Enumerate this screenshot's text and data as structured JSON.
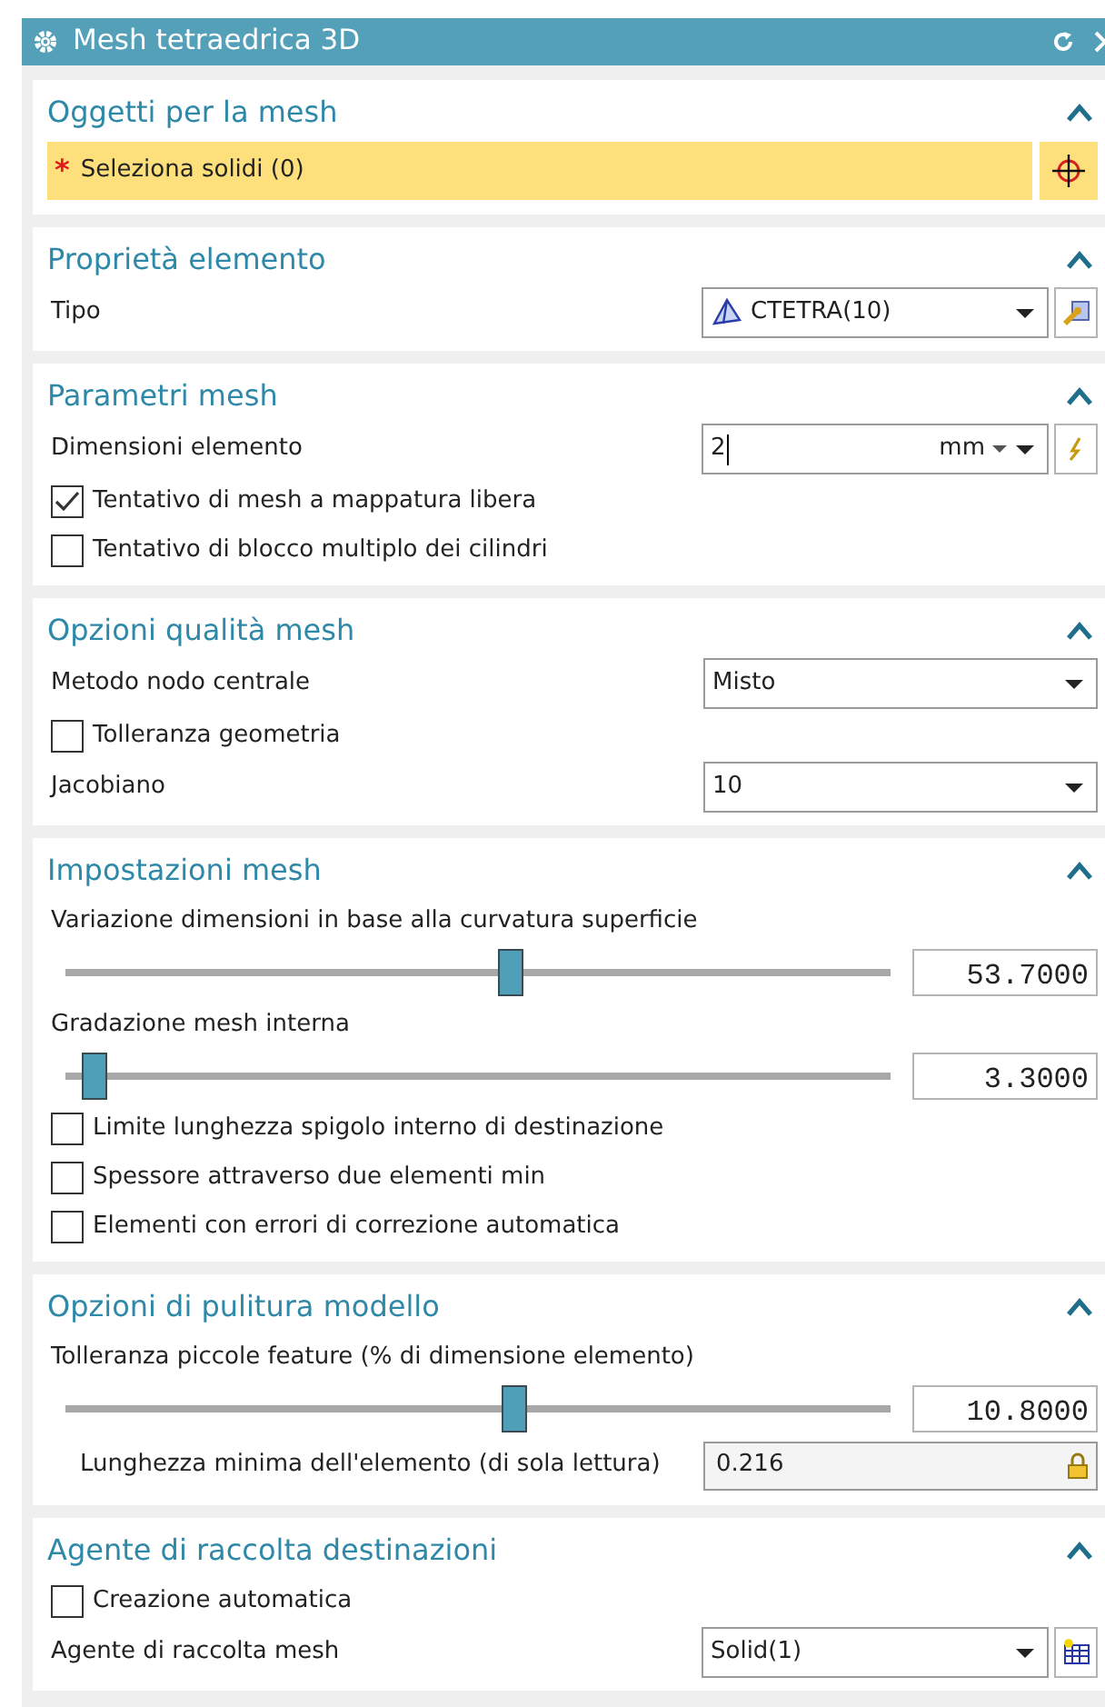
{
  "window": {
    "title": "Mesh tetraedrica 3D"
  },
  "sections": [
    {
      "title": "Oggetti per la mesh",
      "expanded": true,
      "rows": [
        {
          "kind": "selection",
          "mark": "*",
          "label": "Seleziona solidi (0)"
        }
      ]
    },
    {
      "title": "Proprietà elemento",
      "expanded": true,
      "rows": [
        {
          "kind": "dropdown",
          "label": "Tipo",
          "value": "CTETRA(10)",
          "value_icon": {
            "kind": "tetra"
          },
          "tool": {
            "kind": "properties"
          }
        }
      ]
    },
    {
      "title": "Parametri mesh",
      "expanded": true,
      "rows": [
        {
          "kind": "unit_input",
          "label": "Dimensioni elemento",
          "value": "2",
          "unit": "mm",
          "focused": true,
          "tool": {
            "kind": "formula"
          }
        },
        {
          "kind": "checkbox",
          "label": "Tentativo di mesh a mappatura libera",
          "checked": true
        },
        {
          "kind": "checkbox",
          "label": "Tentativo di blocco multiplo dei cilindri",
          "checked": false
        }
      ]
    },
    {
      "title": "Opzioni qualità mesh",
      "expanded": true,
      "rows": [
        {
          "kind": "dropdown",
          "label": "Metodo nodo centrale",
          "value": "Misto"
        },
        {
          "kind": "checkbox",
          "label": "Tolleranza geometria",
          "checked": false
        },
        {
          "kind": "dropdown",
          "label": "Jacobiano",
          "value": "10"
        }
      ]
    },
    {
      "title": "Impostazioni mesh",
      "expanded": true,
      "rows": [
        {
          "kind": "label",
          "label": "Variazione dimensioni in base alla curvatura superficie"
        },
        {
          "kind": "slider",
          "level": 0.54,
          "reading": "53.7000"
        },
        {
          "kind": "label",
          "label": "Gradazione mesh interna"
        },
        {
          "kind": "slider",
          "level": 0.035,
          "reading": "3.3000"
        },
        {
          "kind": "checkbox",
          "label": "Limite lunghezza spigolo interno di destinazione",
          "checked": false
        },
        {
          "kind": "checkbox",
          "label": "Spessore attraverso due elementi min",
          "checked": false
        },
        {
          "kind": "checkbox",
          "label": "Elementi con errori di correzione automatica",
          "checked": false
        }
      ]
    },
    {
      "title": "Opzioni di pulitura modello",
      "expanded": true,
      "rows": [
        {
          "kind": "label",
          "label": "Tolleranza piccole feature (% di dimensione elemento)"
        },
        {
          "kind": "slider",
          "level": 0.545,
          "reading": "10.8000"
        },
        {
          "kind": "readonly",
          "label": "Lunghezza minima dell'elemento (di sola lettura)",
          "value": "0.216",
          "locked": true
        }
      ]
    },
    {
      "title": "Agente di raccolta destinazioni",
      "expanded": true,
      "rows": [
        {
          "kind": "checkbox",
          "label": "Creazione automatica",
          "checked": false
        },
        {
          "kind": "dropdown",
          "label": "Agente di raccolta mesh",
          "value": "Solid(1)",
          "tool": {
            "kind": "collector"
          }
        }
      ]
    }
  ]
}
